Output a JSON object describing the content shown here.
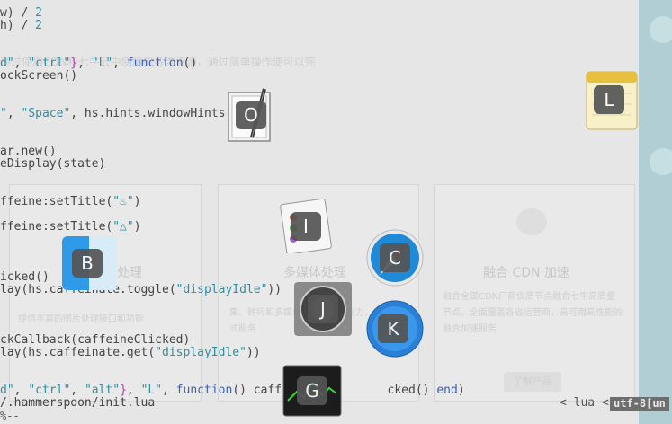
{
  "editor": {
    "lines": [
      [
        {
          "t": "w) / ",
          "c": "pl"
        },
        {
          "t": "2",
          "c": "num"
        }
      ],
      [
        {
          "t": "h) / ",
          "c": "pl"
        },
        {
          "t": "2",
          "c": "num"
        }
      ],
      [],
      [],
      [
        {
          "t": "d\"",
          "c": "str"
        },
        {
          "t": ", ",
          "c": "pl"
        },
        {
          "t": "\"ctrl\"",
          "c": "str"
        },
        {
          "t": "}",
          "c": "mag"
        },
        {
          "t": ", ",
          "c": "pl"
        },
        {
          "t": "\"L\"",
          "c": "str"
        },
        {
          "t": ", ",
          "c": "pl"
        },
        {
          "t": "function",
          "c": "kw"
        },
        {
          "t": "()",
          "c": "pl"
        }
      ],
      [
        {
          "t": "ockScreen()",
          "c": "pl"
        }
      ],
      [],
      [],
      [
        {
          "t": "\"",
          "c": "str"
        },
        {
          "t": ", ",
          "c": "pl"
        },
        {
          "t": "\"Space\"",
          "c": "str"
        },
        {
          "t": ", hs.hints.windowHints",
          "c": "pl"
        }
      ],
      [],
      [],
      [
        {
          "t": "ar.new()",
          "c": "pl"
        }
      ],
      [
        {
          "t": "eDisplay(state)",
          "c": "pl"
        }
      ],
      [],
      [],
      [
        {
          "t": "ffeine:setTitle(",
          "c": "pl"
        },
        {
          "t": "\"♨\"",
          "c": "str"
        },
        {
          "t": ")",
          "c": "pl"
        }
      ],
      [],
      [
        {
          "t": "ffeine:setTitle(",
          "c": "pl"
        },
        {
          "t": "\"△\"",
          "c": "str"
        },
        {
          "t": ")",
          "c": "pl"
        }
      ],
      [],
      [],
      [],
      [
        {
          "t": "icked()",
          "c": "pl"
        }
      ],
      [
        {
          "t": "lay(hs.caffeinate.toggle(",
          "c": "pl"
        },
        {
          "t": "\"displayIdle\"",
          "c": "str"
        },
        {
          "t": "))",
          "c": "pl"
        }
      ],
      [],
      [],
      [],
      [
        {
          "t": "ckCallback(caffeineClicked)",
          "c": "pl"
        }
      ],
      [
        {
          "t": "lay(hs.caffeinate.get(",
          "c": "pl"
        },
        {
          "t": "\"displayIdle\"",
          "c": "str"
        },
        {
          "t": "))",
          "c": "pl"
        }
      ],
      [],
      [],
      [
        {
          "t": "d\"",
          "c": "str"
        },
        {
          "t": ", ",
          "c": "pl"
        },
        {
          "t": "\"ctrl\"",
          "c": "str"
        },
        {
          "t": ", ",
          "c": "pl"
        },
        {
          "t": "\"alt\"",
          "c": "str"
        },
        {
          "t": "}",
          "c": "mag"
        },
        {
          "t": ", ",
          "c": "pl"
        },
        {
          "t": "\"L\"",
          "c": "str"
        },
        {
          "t": ", ",
          "c": "pl"
        },
        {
          "t": "function",
          "c": "kw"
        },
        {
          "t": "() caff",
          "c": "pl"
        },
        {
          "t": "               ",
          "c": "pl"
        },
        {
          "t": "cked() ",
          "c": "pl"
        },
        {
          "t": "end",
          "c": "kw"
        },
        {
          "t": ")",
          "c": "pl"
        }
      ]
    ]
  },
  "modeline": {
    "path": "/.hammerspoon/init.lua",
    "lang": "< lua <",
    "encoding": "utf-8[un",
    "status": "%--"
  },
  "background": {
    "headline": "通过使用CDN和七牛云中使用的各类资源，通过简单操作便可以完",
    "card_left_title": "处理",
    "card_mid_title": "多媒体处理",
    "card_right_title": "融合 CDN 加速",
    "card_right_desc": "融合全国CDN厂商优质节点融合七牛高质量节点，全面覆盖各省运营商，高可用高性能的融合加速服务",
    "card_mid_desc": "集、转码和多媒体加工等处理能力，实现一站式服务",
    "card_left_desc": "提供丰富的图片处理接口和功能",
    "button_label": "了解产品"
  },
  "hints": [
    {
      "key": "O",
      "app": "script-editor-icon"
    },
    {
      "key": "L",
      "app": "notes-icon"
    },
    {
      "key": "I",
      "app": "text-edit-icon"
    },
    {
      "key": "B",
      "app": "finder-icon"
    },
    {
      "key": "C",
      "app": "safari-icon"
    },
    {
      "key": "J",
      "app": "system-preferences-icon"
    },
    {
      "key": "K",
      "app": "app-store-icon"
    },
    {
      "key": "G",
      "app": "activity-monitor-icon"
    }
  ]
}
